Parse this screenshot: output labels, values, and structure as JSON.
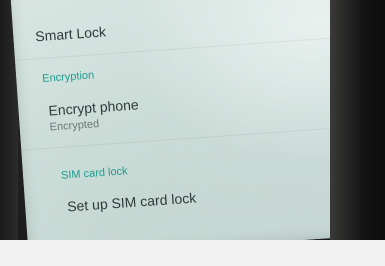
{
  "settings": {
    "smart_lock": {
      "title": "Smart Lock"
    },
    "encryption_header": "Encryption",
    "encrypt_phone": {
      "title": "Encrypt phone",
      "status": "Encrypted"
    },
    "sim_header": "SIM card lock",
    "sim_lock": {
      "title": "Set up SIM card lock"
    }
  },
  "colors": {
    "section_header": "#1c9c8f",
    "screen_background": "#d4e3df"
  }
}
